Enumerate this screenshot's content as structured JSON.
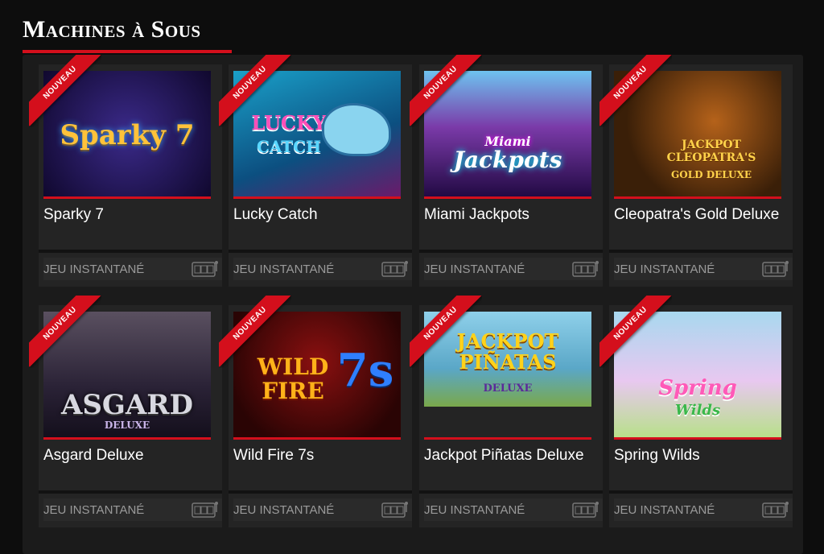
{
  "header": {
    "title": "Machines à Sous"
  },
  "games": [
    {
      "name": "Sparky 7",
      "badge": "NOUVEAU",
      "mode": "JEU INSTANTANÉ",
      "art": "Sparky 7",
      "art_sub": "",
      "bg": "#1b1350"
    },
    {
      "name": "Lucky Catch",
      "badge": "NOUVEAU",
      "mode": "JEU INSTANTANÉ",
      "art": "LUCKY",
      "art_sub": "CATCH",
      "bg": "#0e6e9a"
    },
    {
      "name": "Miami Jackpots",
      "badge": "NOUVEAU",
      "mode": "JEU INSTANTANÉ",
      "art": "Miami",
      "art_sub": "Jackpots",
      "bg": "#5a1d7a"
    },
    {
      "name": "Cleopatra's Gold Deluxe",
      "badge": "NOUVEAU",
      "mode": "JEU INSTANTANÉ",
      "art": "JACKPOT CLEOPATRA'S",
      "art_sub": "GOLD DELUXE",
      "bg": "#3a1f08"
    },
    {
      "name": "Asgard Deluxe",
      "badge": "NOUVEAU",
      "mode": "JEU INSTANTANÉ",
      "art": "ASGARD",
      "art_sub": "DELUXE",
      "bg": "#2a2236"
    },
    {
      "name": "Wild Fire 7s",
      "badge": "NOUVEAU",
      "mode": "JEU INSTANTANÉ",
      "art": "WILD FIRE",
      "art_sub": "7s",
      "bg": "#5a0a0a"
    },
    {
      "name": "Jackpot Piñatas Deluxe",
      "badge": "NOUVEAU",
      "mode": "JEU INSTANTANÉ",
      "art": "JACKPOT PIÑATAS",
      "art_sub": "DELUXE",
      "bg": "#5aa7c7"
    },
    {
      "name": "Spring Wilds",
      "badge": "NOUVEAU",
      "mode": "JEU INSTANTANÉ",
      "art": "Spring",
      "art_sub": "Wilds",
      "bg": "#a8d8ef"
    }
  ]
}
